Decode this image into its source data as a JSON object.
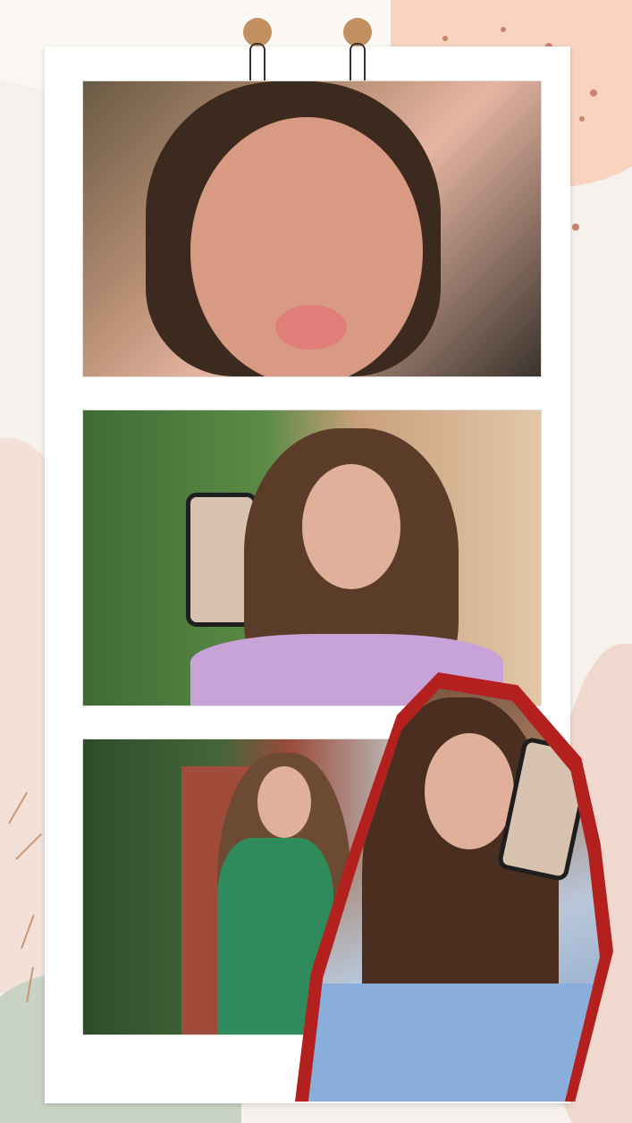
{
  "colors": {
    "background": "#f6f1ec",
    "frame": "#ffffff",
    "clip": "#c49060",
    "cutout_border": "#b3201d"
  },
  "photos": [
    {
      "description_icon": "selfie-kiss-photo"
    },
    {
      "description_icon": "mirror-selfie-garden-photo"
    },
    {
      "description_icon": "green-sweater-brick-gate-photo"
    }
  ],
  "cutout": {
    "description_icon": "blue-cardigan-mirror-selfie-cutout"
  }
}
